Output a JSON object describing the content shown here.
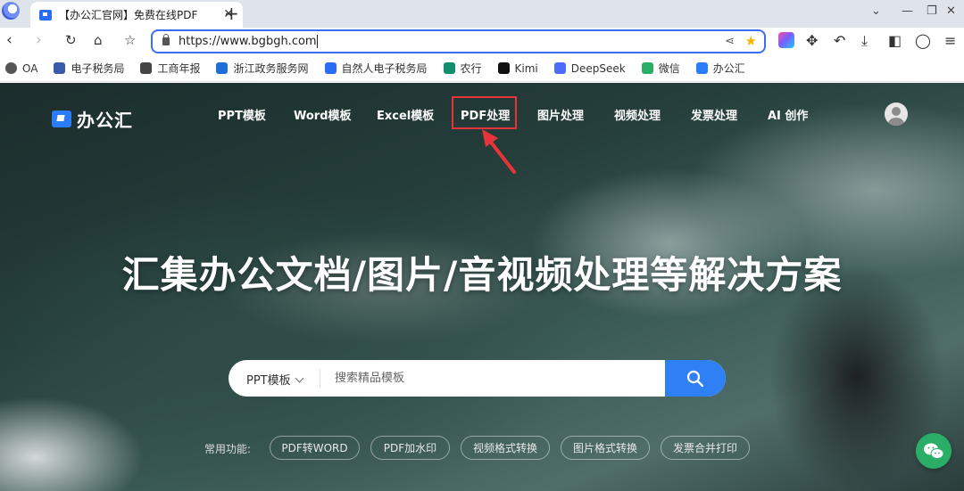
{
  "browser": {
    "tab_title": "【办公汇官网】免费在线PDF",
    "url": "https://www.bgbgh.com"
  },
  "bookmarks": [
    {
      "label": "OA",
      "icon": "globe-icon",
      "color": "#555555"
    },
    {
      "label": "电子税务局",
      "icon": "tax-icon",
      "color": "#3a5ba9"
    },
    {
      "label": "工商年报",
      "icon": "building-icon",
      "color": "#444444"
    },
    {
      "label": "浙江政务服务网",
      "icon": "gov-icon",
      "color": "#1e6fd9"
    },
    {
      "label": "自然人电子税务局",
      "icon": "tax-person-icon",
      "color": "#2a6df4"
    },
    {
      "label": "农行",
      "icon": "bank-icon",
      "color": "#0e8f6e"
    },
    {
      "label": "Kimi",
      "icon": "kimi-icon",
      "color": "#111111"
    },
    {
      "label": "DeepSeek",
      "icon": "deepseek-icon",
      "color": "#4d6bfe"
    },
    {
      "label": "微信",
      "icon": "wechat-icon",
      "color": "#2aae67"
    },
    {
      "label": "办公汇",
      "icon": "bgh-icon",
      "color": "#2a7df6"
    }
  ],
  "site": {
    "logo_text": "办公汇",
    "nav": [
      "PPT模板",
      "Word模板",
      "Excel模板",
      "PDF处理",
      "图片处理",
      "视频处理",
      "发票处理",
      "AI 创作"
    ],
    "highlighted_nav": "PDF处理",
    "hero_title": "汇集办公文档/图片/音视频处理等解决方案",
    "search": {
      "category": "PPT模板",
      "placeholder": "搜索精品模板"
    },
    "quick_label": "常用功能:",
    "quick_links": [
      "PDF转WORD",
      "PDF加水印",
      "视频格式转换",
      "图片格式转换",
      "发票合并打印"
    ]
  },
  "colors": {
    "accent": "#2f7ff5",
    "annotation": "#e8333b",
    "wechat": "#2aae67"
  }
}
